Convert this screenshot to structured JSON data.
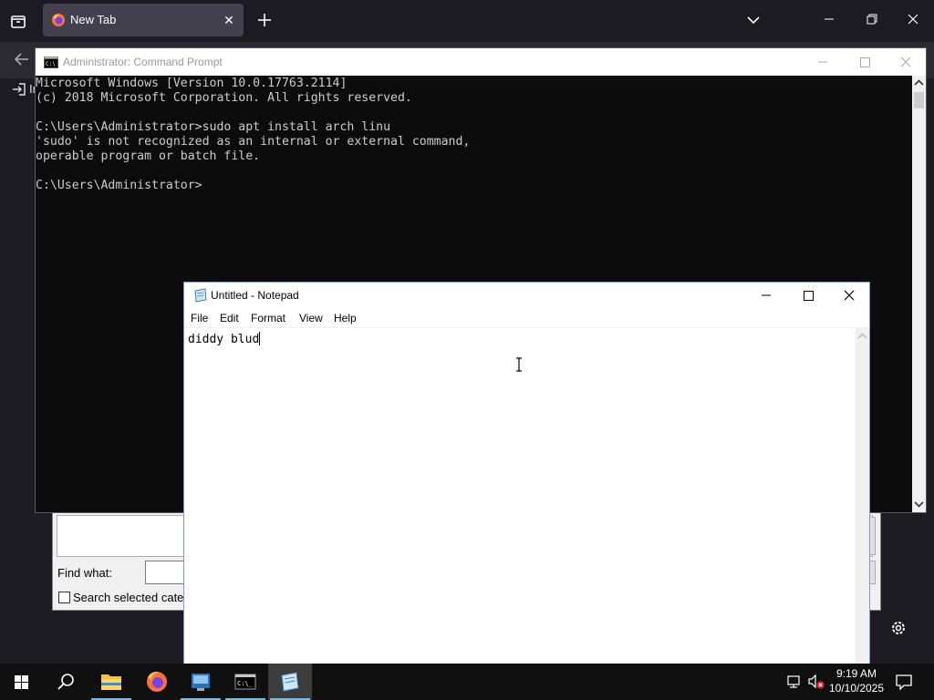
{
  "browser": {
    "tab_title": "New Tab",
    "tab_close": "✕",
    "signin_text": "Im"
  },
  "find_dialog": {
    "find_label": "Find what:",
    "search_selected_label": "Search selected categories"
  },
  "cmd": {
    "title": "Administrator: Command Prompt",
    "output": "Microsoft Windows [Version 10.0.17763.2114]\n(c) 2018 Microsoft Corporation. All rights reserved.\n\nC:\\Users\\Administrator>sudo apt install arch linu\n'sudo' is not recognized as an internal or external command,\noperable program or batch file.\n\nC:\\Users\\Administrator>"
  },
  "notepad": {
    "title": "Untitled - Notepad",
    "menu": [
      "File",
      "Edit",
      "Format",
      "View",
      "Help"
    ],
    "content": "diddy blud"
  },
  "taskbar": {
    "time": "9:19 AM",
    "date": "10/10/2025"
  },
  "colors": {
    "console_bg": "#0c0c0c",
    "console_text": "#cccccc",
    "taskbar_bg": "#101010",
    "firefox_bg": "#1c1b22",
    "accent": "#76b9ed"
  },
  "icons": [
    "list-all-tabs-icon",
    "firefox-icon",
    "plus-icon",
    "chevron-down-icon",
    "back-arrow-icon",
    "signin-icon",
    "gear-icon",
    "cmd-icon",
    "notepad-icon",
    "windows-logo-icon",
    "search-icon",
    "folder-icon",
    "network-icon",
    "volume-muted-icon",
    "notification-icon"
  ]
}
